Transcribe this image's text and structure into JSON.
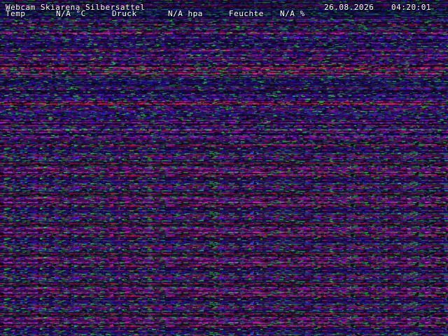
{
  "overlay": {
    "title": "Webcam Skiarena Silbersattel",
    "date": "26.08.2026",
    "time": "04:20:01",
    "temp_label": "Temp",
    "temp_value": "N/A °C",
    "druck_label": "Druck",
    "druck_value": "N/A hpa",
    "feuchte_label": "Feuchte",
    "feuchte_value": "N/A %"
  },
  "colors": {
    "background": "#05004a",
    "noise_blue": "#2a1bff",
    "noise_red": "#ff2a3a",
    "noise_magenta": "#d030c0",
    "noise_green": "#20b040",
    "text": "#ffffff"
  }
}
